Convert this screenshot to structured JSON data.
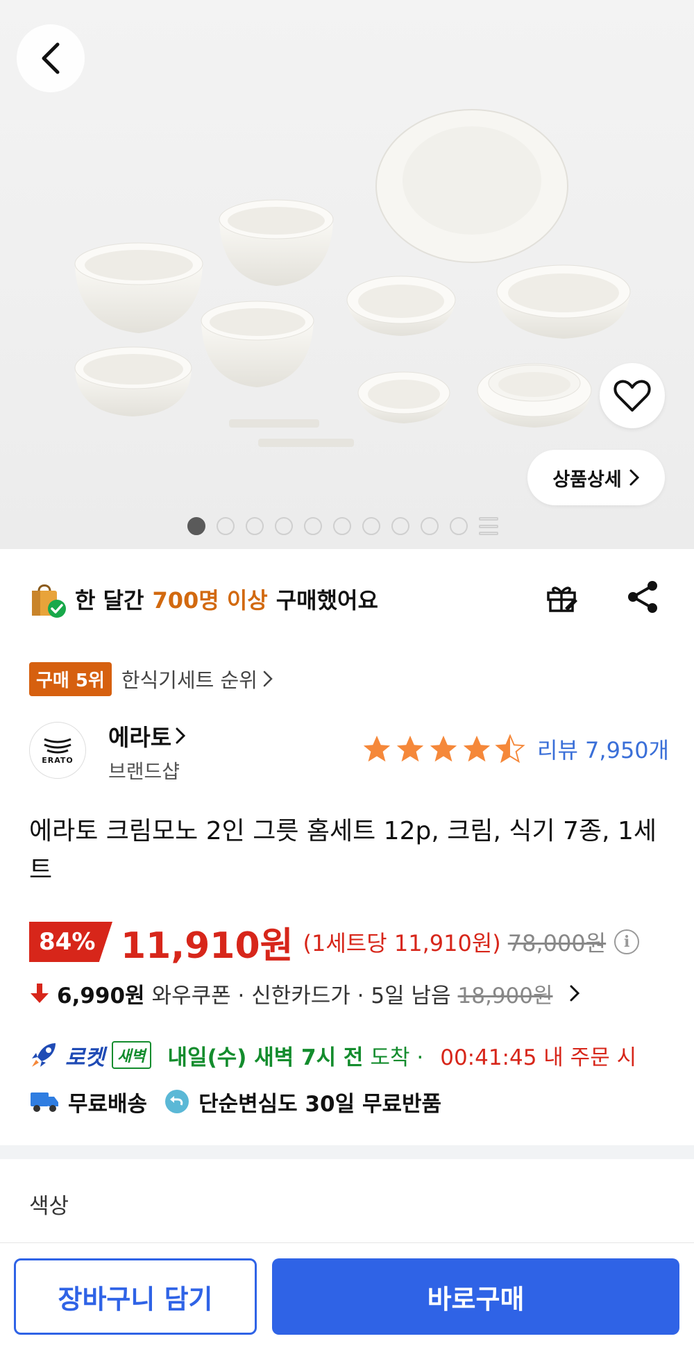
{
  "hero": {
    "detail_label": "상품상세",
    "image_count": 10,
    "active_index": 0
  },
  "purchase_banner": {
    "prefix": "한 달간",
    "highlight": "700명 이상",
    "suffix": "구매했어요"
  },
  "rank": {
    "badge": "구매 5위",
    "category": "한식기세트 순위"
  },
  "brand": {
    "logo_text": "ERATO",
    "name": "에라토",
    "sub": "브랜드샵"
  },
  "rating": {
    "stars": 4.5,
    "review_label": "리뷰 7,950개"
  },
  "product": {
    "title": "에라토 크림모노 2인 그릇 홈세트 12p, 크림, 식기 7종, 1세트"
  },
  "price": {
    "discount": "84%",
    "sale": "11,910원",
    "unit": "(1세트당 11,910원)",
    "original": "78,000원"
  },
  "coupon": {
    "price": "6,990원",
    "desc": "와우쿠폰 · 신한카드가 · 5일 남음",
    "original": "18,900원"
  },
  "delivery": {
    "rocket": "로켓",
    "badge": "새벽",
    "arrive_strong": "내일(수) 새벽 7시 전",
    "arrive_weak": "도착 ·",
    "order_time": "00:41:45 내 주문 시"
  },
  "shipping": {
    "free": "무료배송",
    "returns": "단순변심도 30일 무료반품"
  },
  "options": {
    "color_label": "색상"
  },
  "bottom": {
    "cart": "장바구니 담기",
    "buy": "바로구매"
  },
  "colors": {
    "accent_blue": "#2f63e6",
    "sale_red": "#d7261a",
    "rank_orange": "#d6600f",
    "dawn_green": "#138c2d",
    "star_orange": "#f5883a"
  }
}
